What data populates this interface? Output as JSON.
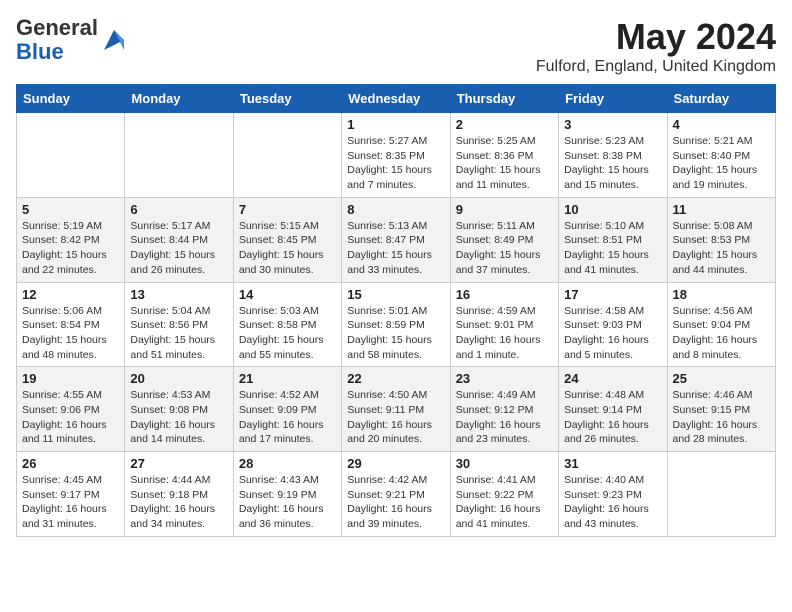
{
  "header": {
    "logo_general": "General",
    "logo_blue": "Blue",
    "month_title": "May 2024",
    "location": "Fulford, England, United Kingdom"
  },
  "weekdays": [
    "Sunday",
    "Monday",
    "Tuesday",
    "Wednesday",
    "Thursday",
    "Friday",
    "Saturday"
  ],
  "weeks": [
    [
      {
        "day": "",
        "info": ""
      },
      {
        "day": "",
        "info": ""
      },
      {
        "day": "",
        "info": ""
      },
      {
        "day": "1",
        "info": "Sunrise: 5:27 AM\nSunset: 8:35 PM\nDaylight: 15 hours\nand 7 minutes."
      },
      {
        "day": "2",
        "info": "Sunrise: 5:25 AM\nSunset: 8:36 PM\nDaylight: 15 hours\nand 11 minutes."
      },
      {
        "day": "3",
        "info": "Sunrise: 5:23 AM\nSunset: 8:38 PM\nDaylight: 15 hours\nand 15 minutes."
      },
      {
        "day": "4",
        "info": "Sunrise: 5:21 AM\nSunset: 8:40 PM\nDaylight: 15 hours\nand 19 minutes."
      }
    ],
    [
      {
        "day": "5",
        "info": "Sunrise: 5:19 AM\nSunset: 8:42 PM\nDaylight: 15 hours\nand 22 minutes."
      },
      {
        "day": "6",
        "info": "Sunrise: 5:17 AM\nSunset: 8:44 PM\nDaylight: 15 hours\nand 26 minutes."
      },
      {
        "day": "7",
        "info": "Sunrise: 5:15 AM\nSunset: 8:45 PM\nDaylight: 15 hours\nand 30 minutes."
      },
      {
        "day": "8",
        "info": "Sunrise: 5:13 AM\nSunset: 8:47 PM\nDaylight: 15 hours\nand 33 minutes."
      },
      {
        "day": "9",
        "info": "Sunrise: 5:11 AM\nSunset: 8:49 PM\nDaylight: 15 hours\nand 37 minutes."
      },
      {
        "day": "10",
        "info": "Sunrise: 5:10 AM\nSunset: 8:51 PM\nDaylight: 15 hours\nand 41 minutes."
      },
      {
        "day": "11",
        "info": "Sunrise: 5:08 AM\nSunset: 8:53 PM\nDaylight: 15 hours\nand 44 minutes."
      }
    ],
    [
      {
        "day": "12",
        "info": "Sunrise: 5:06 AM\nSunset: 8:54 PM\nDaylight: 15 hours\nand 48 minutes."
      },
      {
        "day": "13",
        "info": "Sunrise: 5:04 AM\nSunset: 8:56 PM\nDaylight: 15 hours\nand 51 minutes."
      },
      {
        "day": "14",
        "info": "Sunrise: 5:03 AM\nSunset: 8:58 PM\nDaylight: 15 hours\nand 55 minutes."
      },
      {
        "day": "15",
        "info": "Sunrise: 5:01 AM\nSunset: 8:59 PM\nDaylight: 15 hours\nand 58 minutes."
      },
      {
        "day": "16",
        "info": "Sunrise: 4:59 AM\nSunset: 9:01 PM\nDaylight: 16 hours\nand 1 minute."
      },
      {
        "day": "17",
        "info": "Sunrise: 4:58 AM\nSunset: 9:03 PM\nDaylight: 16 hours\nand 5 minutes."
      },
      {
        "day": "18",
        "info": "Sunrise: 4:56 AM\nSunset: 9:04 PM\nDaylight: 16 hours\nand 8 minutes."
      }
    ],
    [
      {
        "day": "19",
        "info": "Sunrise: 4:55 AM\nSunset: 9:06 PM\nDaylight: 16 hours\nand 11 minutes."
      },
      {
        "day": "20",
        "info": "Sunrise: 4:53 AM\nSunset: 9:08 PM\nDaylight: 16 hours\nand 14 minutes."
      },
      {
        "day": "21",
        "info": "Sunrise: 4:52 AM\nSunset: 9:09 PM\nDaylight: 16 hours\nand 17 minutes."
      },
      {
        "day": "22",
        "info": "Sunrise: 4:50 AM\nSunset: 9:11 PM\nDaylight: 16 hours\nand 20 minutes."
      },
      {
        "day": "23",
        "info": "Sunrise: 4:49 AM\nSunset: 9:12 PM\nDaylight: 16 hours\nand 23 minutes."
      },
      {
        "day": "24",
        "info": "Sunrise: 4:48 AM\nSunset: 9:14 PM\nDaylight: 16 hours\nand 26 minutes."
      },
      {
        "day": "25",
        "info": "Sunrise: 4:46 AM\nSunset: 9:15 PM\nDaylight: 16 hours\nand 28 minutes."
      }
    ],
    [
      {
        "day": "26",
        "info": "Sunrise: 4:45 AM\nSunset: 9:17 PM\nDaylight: 16 hours\nand 31 minutes."
      },
      {
        "day": "27",
        "info": "Sunrise: 4:44 AM\nSunset: 9:18 PM\nDaylight: 16 hours\nand 34 minutes."
      },
      {
        "day": "28",
        "info": "Sunrise: 4:43 AM\nSunset: 9:19 PM\nDaylight: 16 hours\nand 36 minutes."
      },
      {
        "day": "29",
        "info": "Sunrise: 4:42 AM\nSunset: 9:21 PM\nDaylight: 16 hours\nand 39 minutes."
      },
      {
        "day": "30",
        "info": "Sunrise: 4:41 AM\nSunset: 9:22 PM\nDaylight: 16 hours\nand 41 minutes."
      },
      {
        "day": "31",
        "info": "Sunrise: 4:40 AM\nSunset: 9:23 PM\nDaylight: 16 hours\nand 43 minutes."
      },
      {
        "day": "",
        "info": ""
      }
    ]
  ]
}
